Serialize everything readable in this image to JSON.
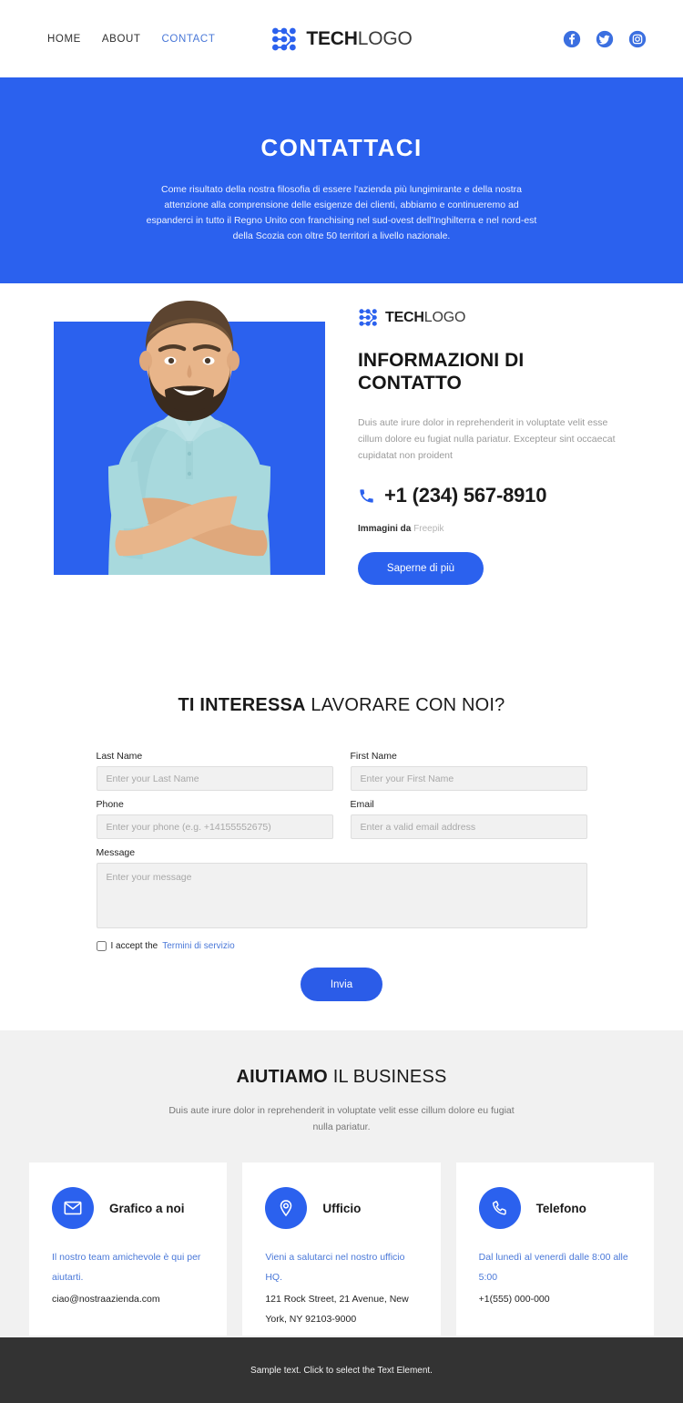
{
  "header": {
    "nav": [
      {
        "label": "HOME",
        "active": false
      },
      {
        "label": "ABOUT",
        "active": false
      },
      {
        "label": "CONTACT",
        "active": true
      }
    ],
    "brand": {
      "bold": "TECH",
      "light": "LOGO"
    },
    "socials": [
      {
        "name": "facebook-icon"
      },
      {
        "name": "twitter-icon"
      },
      {
        "name": "instagram-icon"
      }
    ]
  },
  "hero": {
    "title": "CONTATTACI",
    "paragraph": "Come risultato della nostra filosofia di essere l'azienda più lungimirante e della nostra attenzione alla comprensione delle esigenze dei clienti, abbiamo e continueremo ad espanderci in tutto il Regno Unito con franchising nel sud-ovest dell'Inghilterra e nel nord-est della Scozia con oltre 50 territori a livello nazionale."
  },
  "info": {
    "brand": {
      "bold": "TECH",
      "light": "LOGO"
    },
    "heading": "INFORMAZIONI DI CONTATTO",
    "lead": "Duis aute irure dolor in reprehenderit in voluptate velit esse cillum dolore eu fugiat nulla pariatur. Excepteur sint occaecat cupidatat non proident",
    "phone": "+1 (234) 567-8910",
    "credit_label": "Immagini da",
    "credit_source": "Freepik",
    "button": "Saperne di più",
    "photo_alt": "smiling bearded man with crossed arms"
  },
  "form_section": {
    "title_bold": "TI INTERESSA",
    "title_rest": " LAVORARE CON NOI?",
    "fields": {
      "last_name": {
        "label": "Last Name",
        "placeholder": "Enter your Last Name",
        "value": ""
      },
      "first_name": {
        "label": "First Name",
        "placeholder": "Enter your First Name",
        "value": ""
      },
      "phone": {
        "label": "Phone",
        "placeholder": "Enter your phone (e.g. +14155552675)",
        "value": ""
      },
      "email": {
        "label": "Email",
        "placeholder": "Enter a valid email address",
        "value": ""
      },
      "message": {
        "label": "Message",
        "placeholder": "Enter your message",
        "value": ""
      }
    },
    "accept_prefix": "I accept the",
    "accept_link": "Termini di servizio",
    "accept_checked": false,
    "submit": "Invia"
  },
  "help_section": {
    "title_bold": "AIUTIAMO",
    "title_rest": " IL BUSINESS",
    "subtitle": "Duis aute irure dolor in reprehenderit in voluptate velit esse cillum dolore eu fugiat nulla pariatur.",
    "cards": [
      {
        "icon": "envelope-icon",
        "title": "Grafico a noi",
        "line1": "Il nostro team amichevole è qui per aiutarti.",
        "line2": "ciao@nostraazienda.com"
      },
      {
        "icon": "map-pin-icon",
        "title": "Ufficio",
        "line1": "Vieni a salutarci nel nostro ufficio HQ.",
        "line2": "121 Rock Street, 21 Avenue, New York, NY 92103-9000"
      },
      {
        "icon": "phone-icon",
        "title": "Telefono",
        "line1": "Dal lunedì al venerdì dalle 8:00 alle 5:00",
        "line2": "+1(555) 000-000"
      }
    ]
  },
  "footer": {
    "text": "Sample text. Click to select the Text Element."
  },
  "colors": {
    "brand_blue": "#2b61ee",
    "link_blue": "#4a78d8",
    "gray_bg": "#f1f1f1",
    "footer_bg": "#333333"
  }
}
